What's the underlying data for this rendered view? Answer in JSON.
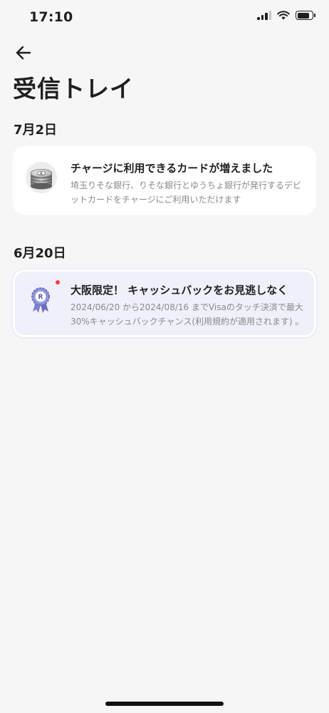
{
  "status_bar": {
    "time": "17:10",
    "signal_icon": "cellular-signal-icon",
    "wifi_icon": "wifi-icon",
    "battery_icon": "battery-icon",
    "battery_level": 0.8
  },
  "header": {
    "back_icon": "arrow-left-icon",
    "title": "受信トレイ"
  },
  "sections": [
    {
      "date": "7月2日",
      "messages": [
        {
          "icon": "coin-stack-icon",
          "title": "チャージに利用できるカードが増えました",
          "body": "埼玉りそな銀行、りそな銀行とゆうちょ銀行が発行するデビットカードをチャージにご利用いただけます",
          "unread": false
        }
      ]
    },
    {
      "date": "6月20日",
      "messages": [
        {
          "icon": "award-ribbon-icon",
          "title": "大阪限定！ キャッシュバックをお見逃しなく",
          "body": "2024/06/20 から2024/08/16 までVisaのタッチ決済で最大30%キャッシュバックチャンス(利用規約が適用されます) 。",
          "unread": true
        }
      ]
    }
  ],
  "colors": {
    "background": "#f6f6f6",
    "card": "#ffffff",
    "highlight_card": "#f0f0fb",
    "unread_dot": "#ff3b30",
    "secondary_text": "#8a8a8a"
  }
}
